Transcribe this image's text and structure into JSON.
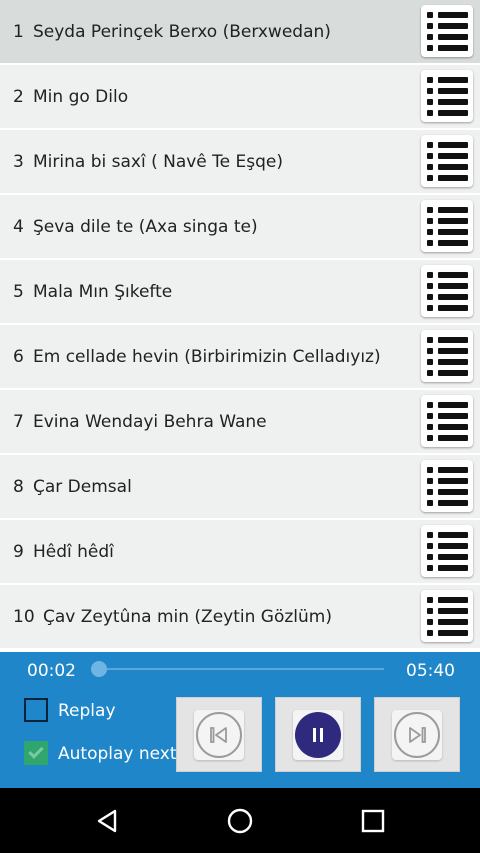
{
  "tracks": [
    {
      "num": "1",
      "title": "Seyda Perinçek Berxo (Berxwedan)"
    },
    {
      "num": "2",
      "title": "Min go Dilo"
    },
    {
      "num": "3",
      "title": "Mirina bi saxî ( Navê Te Eşqe)"
    },
    {
      "num": "4",
      "title": "Şeva dile te (Axa singa te)"
    },
    {
      "num": "5",
      "title": "Mala Mın Şıkefte"
    },
    {
      "num": "6",
      "title": "Em cellade hevin (Birbirimizin Celladıyız)"
    },
    {
      "num": "7",
      "title": "Evina Wendayi Behra Wane"
    },
    {
      "num": "8",
      "title": "Çar Demsal"
    },
    {
      "num": "9",
      "title": "Hêdî hêdî"
    },
    {
      "num": "10",
      "title": "Çav Zeytûna min (Zeytin Gözlüm)"
    }
  ],
  "player": {
    "current_time": "00:02",
    "total_time": "05:40",
    "progress": 0.006,
    "replay_label": "Replay",
    "replay_checked": false,
    "autoplay_label": "Autoplay next",
    "autoplay_checked": true
  },
  "colors": {
    "player_bg": "#1f87c9",
    "pause_button": "#2f2a7d",
    "checkbox_checked": "#2fa66e"
  },
  "icons": {
    "row_menu": "list-menu-icon",
    "prev": "skip-previous-icon",
    "pause": "pause-icon",
    "next": "skip-next-icon",
    "nav_back": "nav-back-icon",
    "nav_home": "nav-home-icon",
    "nav_recents": "nav-recents-icon"
  }
}
